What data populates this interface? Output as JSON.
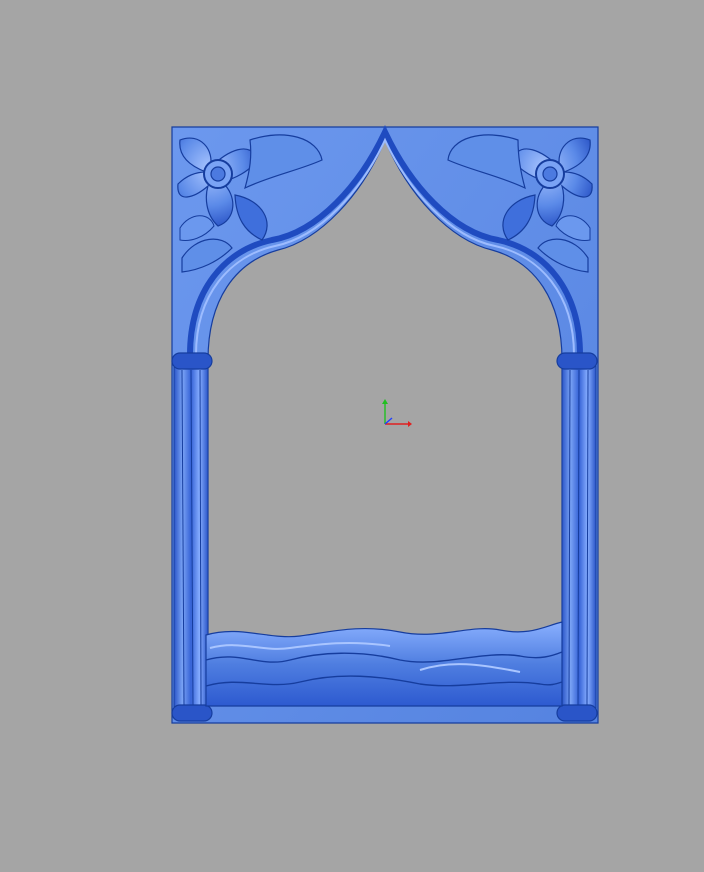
{
  "viewport": {
    "background_color": "#a5a5a5"
  },
  "model": {
    "kind": "carved relief arch frame",
    "base_color": "#5f8fe8",
    "dark_color": "#1f4fc8",
    "light_color": "#8fb3ff",
    "outline_color": "#163d9e"
  },
  "axis_triad": {
    "x_color": "#e02020",
    "y_color": "#20c020",
    "z_color": "#2040ff"
  }
}
